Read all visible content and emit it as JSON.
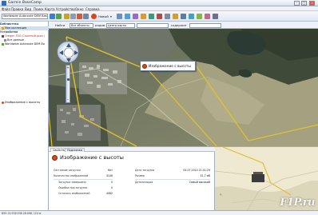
{
  "window": {
    "title": "Garmin BaseCamp",
    "minimize_label": "–",
    "maximize_label": "□",
    "close_label": "×"
  },
  "menu": {
    "items": [
      "Файл",
      "Правка",
      "Вид",
      "Поиск",
      "Карта",
      "Устройство",
      "Окно",
      "Справка"
    ]
  },
  "toolbar": {
    "map_product": "Worldwide Autoroute DEM Basemap, NR",
    "new_label": "Новый",
    "new_dropdown": "▾"
  },
  "sidebar": {
    "rows": [
      {
        "label": "Библиотека",
        "kind": "header"
      },
      {
        "label": "Моя коллекция",
        "kind": "item",
        "selected": true
      },
      {
        "label": "Устройства",
        "kind": "header"
      },
      {
        "label": "Oregon 550 (Съемный диск)",
        "kind": "item"
      },
      {
        "label": "Все данные",
        "kind": "item"
      },
      {
        "label": "Worldwide Autoroute DEM Ba",
        "kind": "item"
      },
      {
        "label": "Изображение с высоты",
        "kind": "item"
      }
    ]
  },
  "searchbar": {
    "find_label": "Найти",
    "scope_value": "Все объекты",
    "near_label": "рядом",
    "center_value": "Центр карты",
    "contains_label": "содержит"
  },
  "map": {
    "callout_text": "Изображение с высоты",
    "zoom_in_label": "+",
    "zoom_out_label": "–"
  },
  "details": {
    "tabs": [
      "Свойства",
      "Подсказка"
    ],
    "title": "Изображение с высоты",
    "left_props": [
      {
        "label": "Состояние загрузки",
        "value": "Нет"
      },
      {
        "label": "Количество изображений",
        "value": "4106"
      },
      {
        "label": "Загрузка завершена",
        "value": "0"
      },
      {
        "label": "Ошибка при загрузке",
        "value": "0"
      },
      {
        "label": "Осталось изображений",
        "value": "4082"
      }
    ],
    "right_props": [
      {
        "label": "Дата загрузки",
        "value": "04.07.2010 21:41:29"
      },
      {
        "label": "Размер",
        "value": "52,7 мб"
      },
      {
        "label": "Детализация",
        "value": "Самый высокий"
      }
    ]
  },
  "inset": {
    "watermark": "F1P.ru"
  },
  "status": {
    "coords": "N55 25.538 E38 28.098, 124 м"
  },
  "colors": {
    "track": "#e0c030",
    "accent": "#2a6fbf",
    "poi": "#d64a1a"
  }
}
